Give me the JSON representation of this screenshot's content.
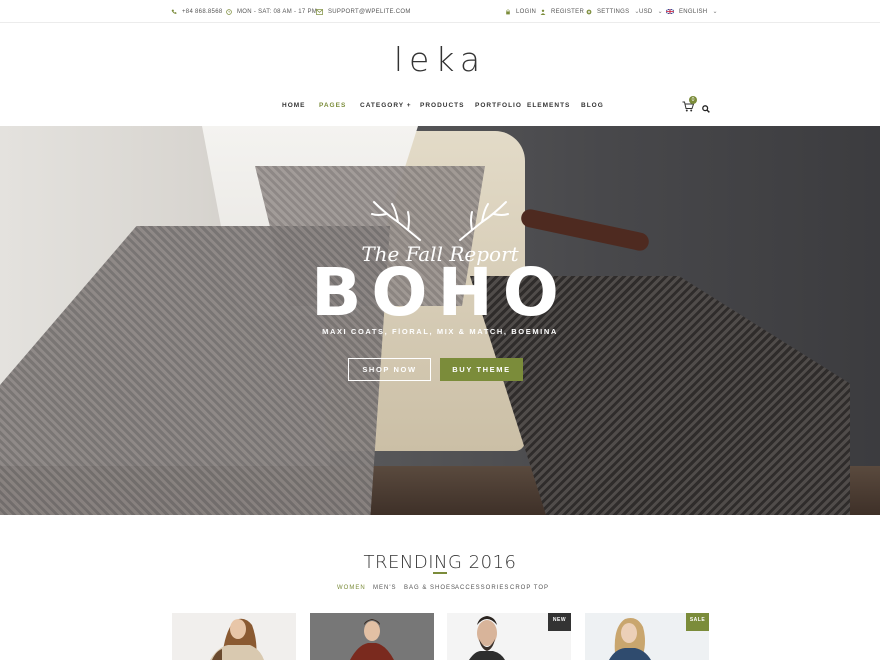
{
  "topbar": {
    "phone": "+84 868.8568",
    "hours": "MON - SAT: 08 AM - 17 PM",
    "email": "SUPPORT@WPELITE.COM",
    "login": "LOGIN",
    "register": "REGISTER",
    "settings": "SETTINGS",
    "currency": "USD",
    "language": "ENGLISH"
  },
  "brand": {
    "logo": "leka"
  },
  "nav": {
    "items": [
      {
        "label": "HOME"
      },
      {
        "label": "PAGES"
      },
      {
        "label": "CATEGORY +"
      },
      {
        "label": "PRODUCTS"
      },
      {
        "label": "PORTFOLIO"
      },
      {
        "label": "ELEMENTS"
      },
      {
        "label": "BLOG"
      }
    ],
    "active": "PAGES",
    "cart_count": "0"
  },
  "hero": {
    "script_title": "The Fall Report",
    "headline": "BOHO",
    "tagline": "MAXI COATS, FlORAL, MIX & MATCH, BOEMINA",
    "shop_button": "SHOP NOW",
    "buy_button": "BUY THEME"
  },
  "trending": {
    "title": "TRENDING 2016",
    "tabs": [
      "WOMEN",
      "MEN'S",
      "BAG & SHOES",
      "ACCESSORIES",
      "CROP TOP"
    ],
    "active_tab": "WOMEN",
    "products": [
      {
        "badge": ""
      },
      {
        "badge": ""
      },
      {
        "badge": "NEW"
      },
      {
        "badge": "SALE"
      }
    ]
  },
  "colors": {
    "accent": "#7b8c3a",
    "badge_new": "#333333"
  }
}
